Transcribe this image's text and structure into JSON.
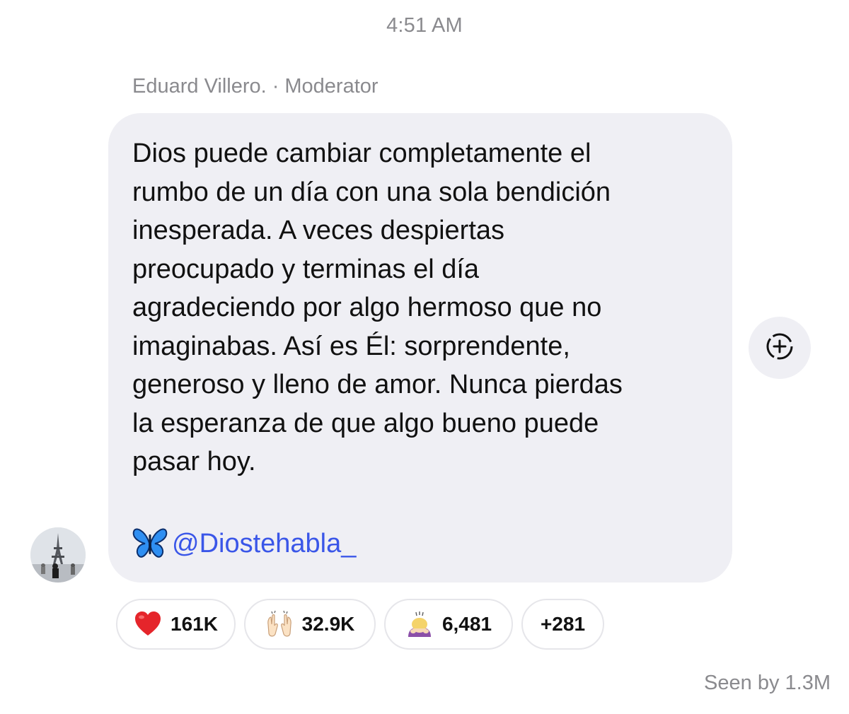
{
  "timestamp": "4:51 AM",
  "sender": {
    "name": "Eduard Villero.",
    "separator": "·",
    "role": "Moderator"
  },
  "message": {
    "text": "Dios puede cambiar completamente el\nrumbo de un día con una sola bendición\ninesperada. A veces despiertas\npreocupado y terminas el día\nagradeciendo por algo hermoso que no\nimaginabas. Así es Él: sorprendente,\ngeneroso y lleno de amor. Nunca pierdas\nla esperanza de que algo bueno puede\npasar hoy.",
    "signature_icon": "butterfly-icon",
    "handle": "@Diostehabla_",
    "link_color": "#3a56e8"
  },
  "reactions": [
    {
      "icon": "red-heart-icon",
      "count": "161K"
    },
    {
      "icon": "raising-hands-icon",
      "count": "32.9K"
    },
    {
      "icon": "person-bowing-icon",
      "count": "6,481"
    },
    {
      "icon": "",
      "count": "+281"
    }
  ],
  "seen": "Seen by 1.3M",
  "add_reaction_icon": "add-reaction-icon",
  "colors": {
    "bubble": "#efeff4",
    "meta_text": "#8a8a8e"
  }
}
